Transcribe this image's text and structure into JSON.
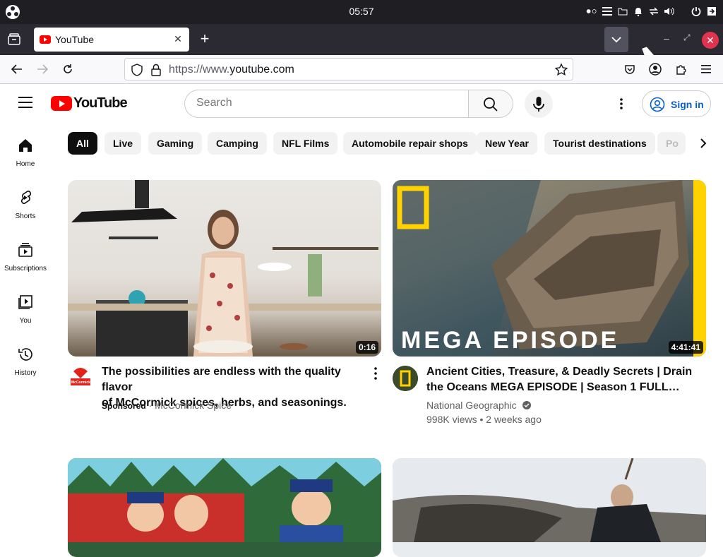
{
  "system": {
    "clock": "05:57"
  },
  "browser": {
    "tab_title": "YouTube",
    "new_tab_label": "+",
    "url_protocol": "https://www.",
    "url_domain": "youtube.com"
  },
  "youtube": {
    "logo_text": "YouTube",
    "search_placeholder": "Search",
    "sign_in_label": "Sign in",
    "sidebar": [
      {
        "label": "Home",
        "icon": "home-icon"
      },
      {
        "label": "Shorts",
        "icon": "shorts-icon"
      },
      {
        "label": "Subscriptions",
        "icon": "subscriptions-icon"
      },
      {
        "label": "You",
        "icon": "you-icon"
      },
      {
        "label": "History",
        "icon": "history-icon"
      }
    ],
    "chips": [
      "All",
      "Live",
      "Gaming",
      "Camping",
      "NFL Films",
      "Automobile repair shops",
      "New Year",
      "Tourist destinations",
      "Po"
    ],
    "videos": [
      {
        "title_line1": "The possibilities are endless with the quality flavor",
        "title_line2": "of McCormick spices, herbs, and seasonings.",
        "duration": "0:16",
        "sponsored": "Sponsored",
        "separator": "·",
        "channel": "McCormick Spice",
        "avatar_text": "McCormick"
      },
      {
        "title_line1": "Ancient Cities, Treasure, & Deadly Secrets | Drain",
        "title_line2": "the Oceans MEGA EPISODE | Season 1 FULL…",
        "duration": "4:41:41",
        "channel": "National Geographic",
        "stats": "998K views • 2 weeks ago",
        "overlay_text": "MEGA EPISODE"
      }
    ]
  },
  "colors": {
    "yt_red": "#ff0000",
    "link_blue": "#065fd4",
    "ng_yellow": "#ffd200"
  }
}
